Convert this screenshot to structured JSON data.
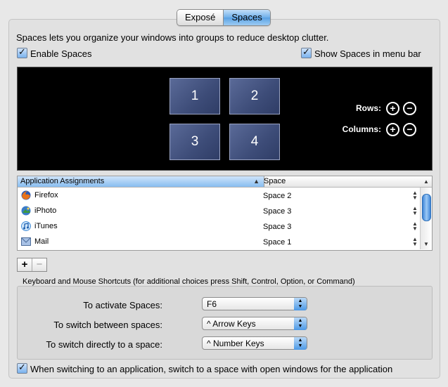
{
  "tabs": [
    {
      "label": "Exposé",
      "selected": false
    },
    {
      "label": "Spaces",
      "selected": true
    }
  ],
  "intro_text": "Spaces lets you organize your windows into groups to reduce desktop clutter.",
  "enable_spaces": {
    "label": "Enable Spaces",
    "checked": true
  },
  "show_in_menu_bar": {
    "label": "Show Spaces in menu bar",
    "checked": true
  },
  "spaces_grid": {
    "spaces": [
      "1",
      "2",
      "3",
      "4"
    ],
    "rows_label": "Rows:",
    "columns_label": "Columns:",
    "plus_glyph": "+",
    "minus_glyph": "−"
  },
  "assignments_table": {
    "columns": [
      "Application Assignments",
      "Space"
    ],
    "rows": [
      {
        "app": "Firefox",
        "space": "Space 2",
        "icon": "firefox-icon"
      },
      {
        "app": "iPhoto",
        "space": "Space 3",
        "icon": "iphoto-icon"
      },
      {
        "app": "iTunes",
        "space": "Space 3",
        "icon": "itunes-icon"
      },
      {
        "app": "Mail",
        "space": "Space 1",
        "icon": "mail-icon"
      }
    ]
  },
  "add_remove": {
    "add": "+",
    "remove": "−"
  },
  "shortcuts": {
    "caption": "Keyboard and Mouse Shortcuts (for additional choices press Shift, Control, Option, or Command)",
    "activate": {
      "label": "To activate Spaces:",
      "value": "F6"
    },
    "switch_between": {
      "label": "To switch between spaces:",
      "value": "^ Arrow Keys"
    },
    "switch_directly": {
      "label": "To switch directly to a space:",
      "value": "^ Number Keys"
    }
  },
  "switch_to_app_space": {
    "label": "When switching to an application, switch to a space with open windows for the application",
    "checked": true
  },
  "colors": {
    "accent": "#5aa1e3",
    "grid_background": "#000000",
    "space_tile": "#3d4c78"
  }
}
